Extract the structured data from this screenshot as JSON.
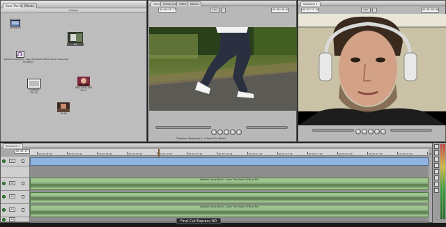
{
  "browser": {
    "tab_project": "Save The World",
    "tab_effects": "Effects",
    "header": "6 items",
    "clips": [
      {
        "name": "Untitled",
        "duration": "00:04:19"
      },
      {
        "name": "",
        "duration": "00"
      },
      {
        "name": "Sbbbb's Amie Bullu - Save The World Official Music Video.mp4",
        "duration": "00:03:22"
      },
      {
        "name": "Untitled",
        "duration": "00:12"
      },
      {
        "name": "IMG_0441.JPG",
        "duration": "10:11"
      },
      {
        "name": "",
        "duration": "10:00"
      }
    ]
  },
  "viewer": {
    "tab_video": "Video",
    "tab_stereo": "Stereo (a1a2)",
    "tab_filters": "Filters",
    "tab_motion": "Motion",
    "timecode_duration": "00:00:05:17",
    "timecode_current": "00:00:00:00",
    "zoom": "51%"
  },
  "canvas": {
    "tab_sequence": "Sequence 1",
    "timecode_duration": "00:03:24:16",
    "timecode_current": "00:00:00:00",
    "zoom": "43%",
    "footer": "Timeline: Sequence 1 in Save The World"
  },
  "timeline": {
    "tab": "Sequence 1",
    "timecode": "00:00:07:00",
    "ruler": [
      "00:00:00:00",
      "00:00:03:00",
      "00:00:06:00",
      "00:00:09:00",
      "00:00:12:00",
      "00:00:15:00",
      "00:00:18:00",
      "00:00:21:00",
      "00:00:24:00",
      "00:00:27:00",
      "00:00:30:00",
      "00:00:33:00",
      "00:00:36:00",
      "00:00:39:00"
    ],
    "tracks": [
      {
        "id": "V1",
        "src": "v1"
      },
      {
        "id": "A1",
        "src": "a1"
      },
      {
        "id": "A2",
        "src": "a2"
      },
      {
        "id": "A3",
        "src": "a3"
      },
      {
        "id": "A4",
        "src": "a4"
      }
    ],
    "audio_clip_label": "Sbbbb's Amie Bullu - Save The World Official Mu"
  },
  "dock": {
    "app_label": "Final Cut Express HD"
  }
}
